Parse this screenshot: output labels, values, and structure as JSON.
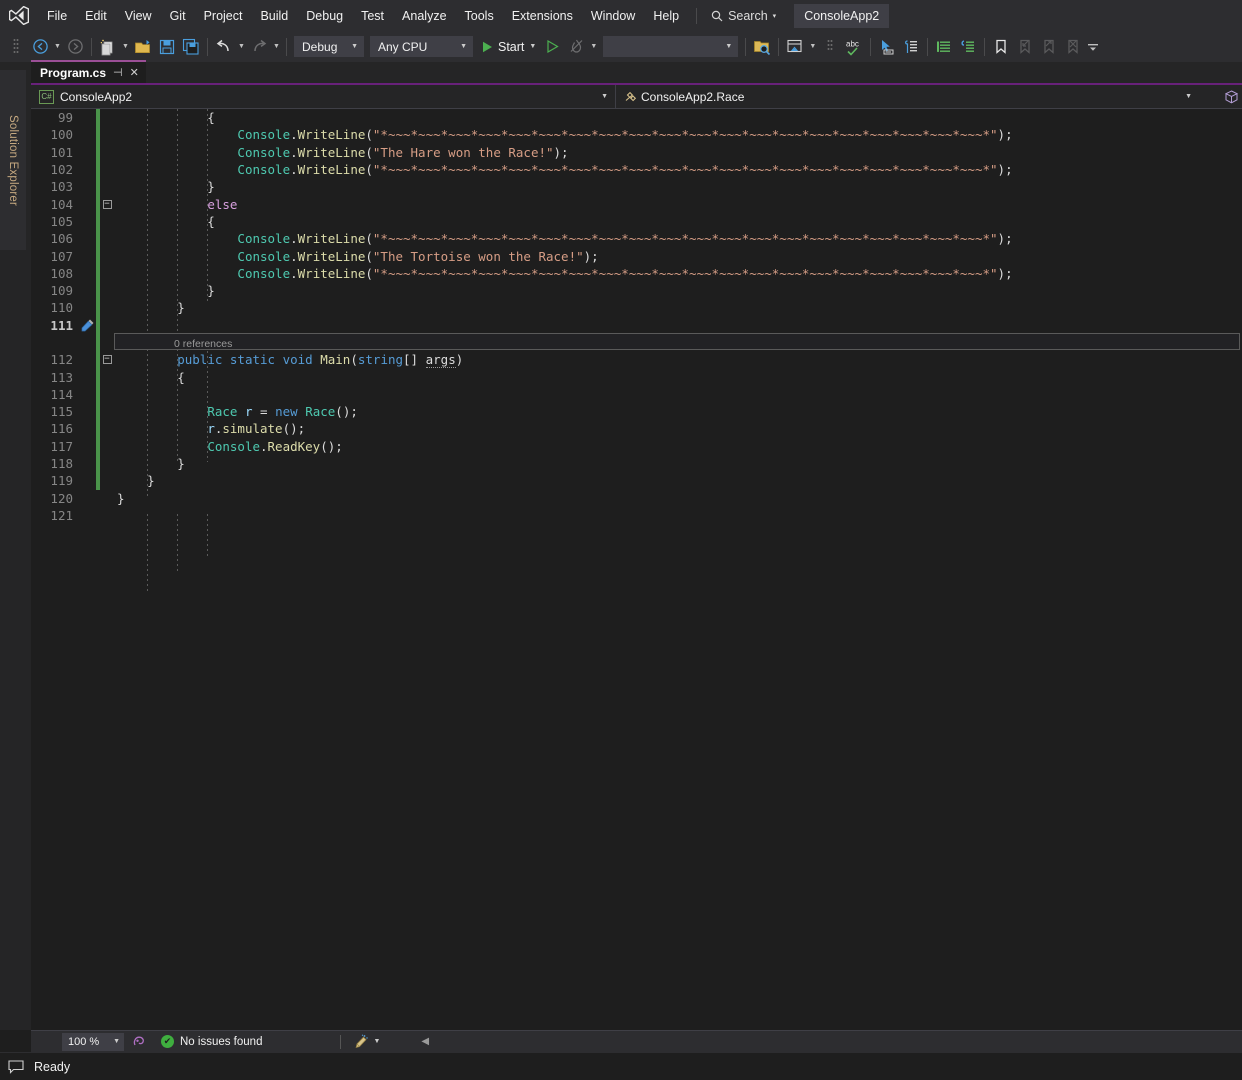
{
  "app": {
    "project_chip": "ConsoleApp2"
  },
  "menubar": {
    "logo_icon": "visual-studio-logo",
    "items": [
      "File",
      "Edit",
      "View",
      "Git",
      "Project",
      "Build",
      "Debug",
      "Test",
      "Analyze",
      "Tools",
      "Extensions",
      "Window",
      "Help"
    ],
    "search": {
      "icon": "search-icon",
      "label": "Search",
      "caret": "▾"
    }
  },
  "toolbar": {
    "nav_back_icon": "navigate-backward-icon",
    "nav_fwd_icon": "navigate-forward-icon",
    "new_project_icon": "new-project-icon",
    "open_file_icon": "open-file-icon",
    "save_icon": "save-icon",
    "save_all_icon": "save-all-icon",
    "undo_icon": "undo-icon",
    "redo_icon": "redo-icon",
    "config_combo": {
      "value": "Debug",
      "caret": "▾"
    },
    "platform_combo": {
      "value": "Any CPU",
      "caret": "▾"
    },
    "start_button": {
      "icon": "play-icon",
      "label": "Start",
      "caret": "▾"
    },
    "start_alt_icon": "play-outline-icon",
    "hotreload_icon": "hot-reload-icon",
    "search_combo": {
      "value": "",
      "caret": "▾"
    },
    "find_in_files_icon": "find-in-files-folder-icon",
    "window_layout_icon": "window-layout-icon",
    "spellcheck_icon": "spell-check-abc-icon",
    "pointer_select_icon": "pointer-select-icon",
    "code_cleanup_icon": "code-cleanup-icon",
    "comment_icon": "comment-lines-icon",
    "uncomment_icon": "uncomment-lines-icon",
    "bookmark_toggle_icon": "bookmark-toggle-icon",
    "bookmark_prev_icon": "bookmark-previous-icon",
    "bookmark_next_icon": "bookmark-next-icon",
    "bookmark_clear_icon": "bookmark-clear-icon",
    "overflow_icon": "toolbar-overflow-icon"
  },
  "left_dock": {
    "solution_explorer_label": "Solution Explorer"
  },
  "editor": {
    "tab": {
      "title": "Program.cs",
      "pin_icon": "pin-icon",
      "close_icon": "close-icon"
    },
    "navbar": {
      "project_badge": "C#",
      "project": "ConsoleApp2",
      "type": "ConsoleApp2.Race",
      "type_icon": "class-icon",
      "caret": "▾",
      "split_icon": "split-view-icon"
    },
    "current_line": 111,
    "quick_actions_icon": "quick-actions-screwdriver-icon",
    "code_lens": "0 references",
    "lines": [
      {
        "n": 99,
        "fold": "",
        "text_html": "            {"
      },
      {
        "n": 100,
        "fold": "",
        "text_html": "                <span class='cls-t'>Console</span><span class='pun'>.</span><span class='mth'>WriteLine</span><span class='pun'>(</span><span class='str'>\"*~~~*~~~*~~~*~~~*~~~*~~~*~~~*~~~*~~~*~~~*~~~*~~~*~~~*~~~*~~~*~~~*~~~*~~~*~~~*~~~*\"</span><span class='pun'>);</span>"
      },
      {
        "n": 101,
        "fold": "",
        "text_html": "                <span class='cls-t'>Console</span><span class='pun'>.</span><span class='mth'>WriteLine</span><span class='pun'>(</span><span class='str'>\"The Hare won the Race!\"</span><span class='pun'>);</span>"
      },
      {
        "n": 102,
        "fold": "",
        "text_html": "                <span class='cls-t'>Console</span><span class='pun'>.</span><span class='mth'>WriteLine</span><span class='pun'>(</span><span class='str'>\"*~~~*~~~*~~~*~~~*~~~*~~~*~~~*~~~*~~~*~~~*~~~*~~~*~~~*~~~*~~~*~~~*~~~*~~~*~~~*~~~*\"</span><span class='pun'>);</span>"
      },
      {
        "n": 103,
        "fold": "",
        "text_html": "            }"
      },
      {
        "n": 104,
        "fold": "−",
        "text_html": "            <span class='ctrl'>else</span>"
      },
      {
        "n": 105,
        "fold": "",
        "text_html": "            {"
      },
      {
        "n": 106,
        "fold": "",
        "text_html": "                <span class='cls-t'>Console</span><span class='pun'>.</span><span class='mth'>WriteLine</span><span class='pun'>(</span><span class='str'>\"*~~~*~~~*~~~*~~~*~~~*~~~*~~~*~~~*~~~*~~~*~~~*~~~*~~~*~~~*~~~*~~~*~~~*~~~*~~~*~~~*\"</span><span class='pun'>);</span>"
      },
      {
        "n": 107,
        "fold": "",
        "text_html": "                <span class='cls-t'>Console</span><span class='pun'>.</span><span class='mth'>WriteLine</span><span class='pun'>(</span><span class='str'>\"The Tortoise won the Race!\"</span><span class='pun'>);</span>"
      },
      {
        "n": 108,
        "fold": "",
        "text_html": "                <span class='cls-t'>Console</span><span class='pun'>.</span><span class='mth'>WriteLine</span><span class='pun'>(</span><span class='str'>\"*~~~*~~~*~~~*~~~*~~~*~~~*~~~*~~~*~~~*~~~*~~~*~~~*~~~*~~~*~~~*~~~*~~~*~~~*~~~*~~~*\"</span><span class='pun'>);</span>"
      },
      {
        "n": 109,
        "fold": "",
        "text_html": "            }"
      },
      {
        "n": 110,
        "fold": "",
        "text_html": "        }"
      },
      {
        "n": 111,
        "fold": "",
        "text_html": "",
        "current": true
      },
      {
        "n": 112,
        "fold": "−",
        "text_html": "        <span class='kw'>public</span> <span class='kw'>static</span> <span class='kw'>void</span> <span class='mth'>Main</span><span class='pun'>(</span><span class='kw'>string</span><span class='pun'>[]</span> <span class='sq'>args</span><span class='pun'>)</span>",
        "codelens": true
      },
      {
        "n": 113,
        "fold": "",
        "text_html": "        {"
      },
      {
        "n": 114,
        "fold": "",
        "text_html": ""
      },
      {
        "n": 115,
        "fold": "",
        "text_html": "            <span class='cls-t'>Race</span> <span class='var'>r</span> <span class='pun'>=</span> <span class='kw'>new</span> <span class='cls-t'>Race</span><span class='pun'>();</span>"
      },
      {
        "n": 116,
        "fold": "",
        "text_html": "            <span class='var'>r</span><span class='pun'>.</span><span class='mth'>simulate</span><span class='pun'>();</span>"
      },
      {
        "n": 117,
        "fold": "",
        "text_html": "            <span class='cls-t'>Console</span><span class='pun'>.</span><span class='mth'>ReadKey</span><span class='pun'>();</span>"
      },
      {
        "n": 118,
        "fold": "",
        "text_html": "        }"
      },
      {
        "n": 119,
        "fold": "",
        "text_html": "    }"
      },
      {
        "n": 120,
        "fold": "",
        "text_html": "}"
      },
      {
        "n": 121,
        "fold": "",
        "text_html": ""
      }
    ]
  },
  "editor_status": {
    "zoom": {
      "value": "100 %",
      "caret": "▾"
    },
    "selection_icon": "selection-mode-icon",
    "issues": {
      "icon": "check-circle-icon",
      "text": "No issues found"
    },
    "cleanup_icon": "code-cleanup-broom-icon",
    "cleanup_caret": "▾",
    "prev_icon": "◀"
  },
  "statusbar": {
    "icon": "notification-icon",
    "text": "Ready"
  },
  "colors": {
    "accent_purple": "#9b4f96",
    "tab_underline": "#68217a",
    "chrome": "#2d2d30",
    "editor_bg": "#1e1e1e",
    "changed_line": "#4a934a",
    "string": "#d69d85",
    "keyword": "#569cd6",
    "type": "#4ec9b0",
    "method": "#dcdcaa",
    "control": "#d8a0df",
    "status_green": "#3fae3f",
    "solution_explorer_text": "#c5a880"
  }
}
